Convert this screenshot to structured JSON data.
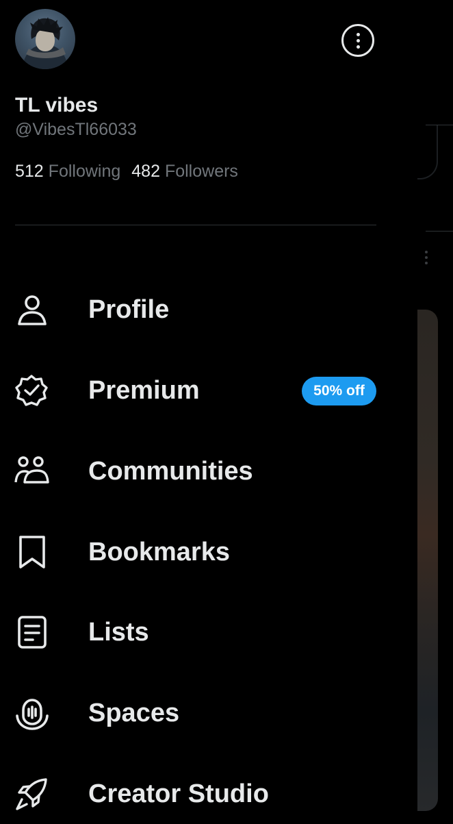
{
  "profile": {
    "display_name": "TL vibes",
    "handle": "@VibesTl66033",
    "following_count": "512",
    "following_label": "Following",
    "followers_count": "482",
    "followers_label": "Followers"
  },
  "menu": {
    "items": [
      {
        "label": "Profile",
        "icon": "person-icon"
      },
      {
        "label": "Premium",
        "icon": "verified-badge-icon",
        "badge": "50% off"
      },
      {
        "label": "Communities",
        "icon": "communities-icon"
      },
      {
        "label": "Bookmarks",
        "icon": "bookmark-icon"
      },
      {
        "label": "Lists",
        "icon": "list-icon"
      },
      {
        "label": "Spaces",
        "icon": "spaces-icon"
      },
      {
        "label": "Creator Studio",
        "icon": "rocket-icon"
      }
    ]
  },
  "colors": {
    "background": "#000000",
    "text_primary": "#e7e9ea",
    "text_secondary": "#71767b",
    "accent": "#1d9bf0",
    "divider": "#2f3336"
  }
}
